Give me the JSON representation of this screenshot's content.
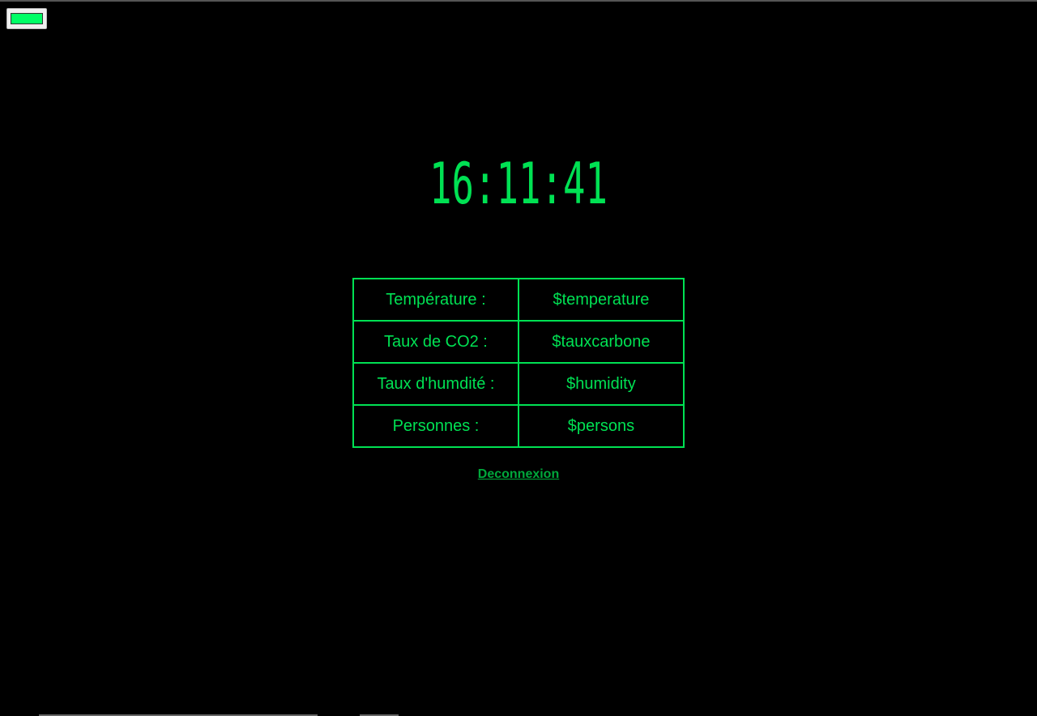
{
  "theme": {
    "accent": "#00e153",
    "link_color": "#00a83b",
    "background": "#000000",
    "toggle_swatch_color": "#00ff66"
  },
  "clock": {
    "time": "16:11:41"
  },
  "sensors": [
    {
      "label": "Température :",
      "value": "$temperature"
    },
    {
      "label": "Taux de CO2 :",
      "value": "$tauxcarbone"
    },
    {
      "label": "Taux d'humdité :",
      "value": "$humidity"
    },
    {
      "label": "Personnes :",
      "value": "$persons"
    }
  ],
  "logout_label": "Deconnexion"
}
